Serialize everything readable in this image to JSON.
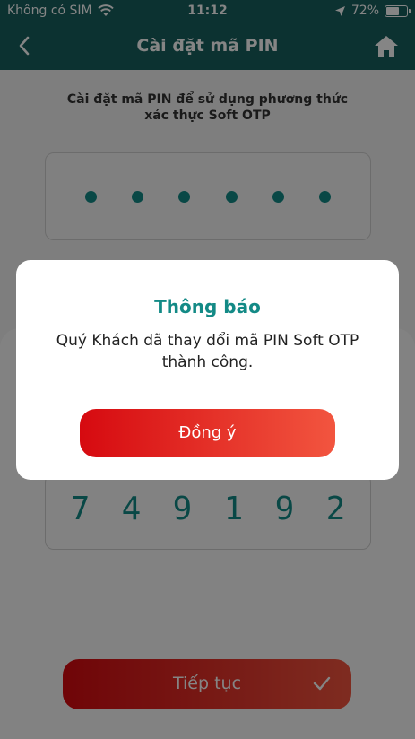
{
  "status_bar": {
    "carrier": "Không có SIM",
    "time": "11:12",
    "battery_percent": "72%",
    "battery_level": 0.72
  },
  "header": {
    "title": "Cài đặt mã PIN",
    "back_icon": "chevron-left-icon",
    "home_icon": "home-icon"
  },
  "pin_setup": {
    "instruction": "Cài đặt mã PIN để sử dụng phương thức xác thực Soft OTP",
    "dot_count": 6
  },
  "otp_code": [
    "7",
    "4",
    "9",
    "1",
    "9",
    "2"
  ],
  "continue_button": {
    "label": "Tiếp tục",
    "icon": "check-icon"
  },
  "dialog": {
    "title": "Thông báo",
    "message": "Quý Khách đã thay đổi mã PIN Soft OTP thành công.",
    "confirm_label": "Đồng ý"
  },
  "colors": {
    "header_bg": "#17605e",
    "accent_teal": "#138a86",
    "button_gradient_start": "#d60a10",
    "button_gradient_end": "#f2553f"
  }
}
